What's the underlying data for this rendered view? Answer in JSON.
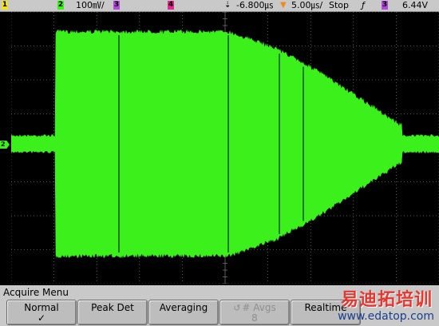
{
  "top_bar": {
    "channel1_num": "1",
    "channel2_num": "2",
    "channel2_scale": "100㎷/",
    "channel3_num": "3",
    "channel4_num": "4",
    "trigger_delay": "-6.800㎲",
    "timebase": "5.00㎲/",
    "run_state": "Stop",
    "trigger_slope_icon": "rising-edge-icon",
    "trigger_source_num": "3",
    "trigger_level": "6.44V"
  },
  "display": {
    "channel_marker": "2",
    "trace_color": "#3bf01b",
    "grid_color": "#6e6e6e",
    "background": "#000000"
  },
  "menu": {
    "title": "Acquire Menu",
    "softkeys": [
      {
        "label": "Normal",
        "sub": "✓",
        "enabled": true
      },
      {
        "label": "Peak Det",
        "sub": "",
        "enabled": true
      },
      {
        "label": "Averaging",
        "sub": "",
        "enabled": true
      },
      {
        "label": "# Avgs",
        "sub": "8",
        "enabled": false,
        "icon": "rotate-knob-icon"
      },
      {
        "label": "Realtime",
        "sub": "",
        "enabled": true
      }
    ]
  },
  "watermark": {
    "cn_text": "易迪拓培训",
    "url": "www.edatop.com"
  }
}
